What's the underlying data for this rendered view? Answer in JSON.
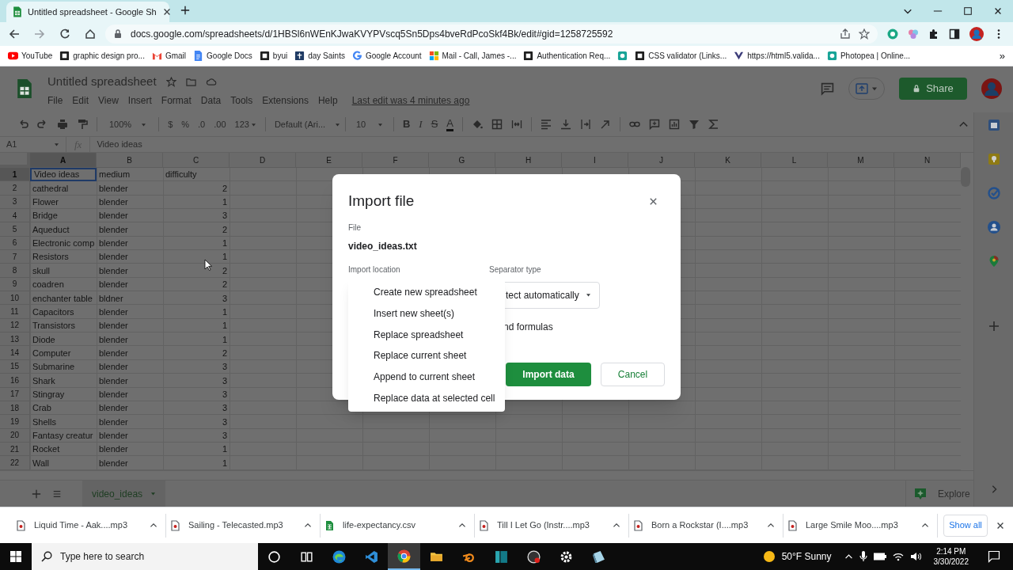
{
  "browser": {
    "tabs": [
      {
        "title": "Untitled spreadsheet - Google Sh",
        "selected": true
      }
    ],
    "url": "docs.google.com/spreadsheets/d/1HBSl6nWEnKJwaKVYPVscq5Sn5Dps4bveRdPcoSkf4Bk/edit#gid=1258725592",
    "bookmarks": [
      {
        "label": "YouTube",
        "kind": "play"
      },
      {
        "label": "graphic design pro...",
        "kind": "dark"
      },
      {
        "label": "Gmail",
        "kind": "mail"
      },
      {
        "label": "Google Docs",
        "kind": "doc"
      },
      {
        "label": "byui",
        "kind": "dark"
      },
      {
        "label": "day Saints",
        "kind": "navy"
      },
      {
        "label": "Google Account",
        "kind": "multi"
      },
      {
        "label": "Mail - Call, James -...",
        "kind": "windows"
      },
      {
        "label": "Authentication Req...",
        "kind": "dark"
      },
      {
        "kind": "teal"
      },
      {
        "label": "CSS validator (Links...",
        "kind": "dark"
      },
      {
        "label": "https://html5.valida...",
        "kind": "figure"
      },
      {
        "label": "Photopea | Online...",
        "kind": "teal"
      }
    ],
    "more": "»"
  },
  "sheets": {
    "title": "Untitled spreadsheet",
    "menus": [
      "File",
      "Edit",
      "View",
      "Insert",
      "Format",
      "Data",
      "Tools",
      "Extensions",
      "Help"
    ],
    "last_edit": "Last edit was 4 minutes ago",
    "share": "Share",
    "toolbar": {
      "zoom": "100%",
      "currency": "$",
      "percent": "%",
      "decrease_decimals": ".0",
      "increase_decimals": ".00",
      "number_format": "123",
      "font": "Default (Ari...",
      "font_size": "10",
      "bold": "B",
      "italic": "I",
      "strikethrough": "S",
      "text_color": "A"
    },
    "name_box": "A1",
    "fx": "fx",
    "formula": "Video ideas",
    "columns": [
      {
        "label": "A",
        "selected": true
      },
      {
        "label": "B",
        "selected": false
      },
      {
        "label": "C",
        "selected": false
      },
      {
        "label": "D",
        "selected": false
      },
      {
        "label": "E",
        "selected": false
      },
      {
        "label": "F",
        "selected": false
      },
      {
        "label": "G",
        "selected": false
      },
      {
        "label": "H",
        "selected": false
      },
      {
        "label": "I",
        "selected": false
      },
      {
        "label": "J",
        "selected": false
      },
      {
        "label": "K",
        "selected": false
      },
      {
        "label": "L",
        "selected": false
      },
      {
        "label": "M",
        "selected": false
      },
      {
        "label": "N",
        "selected": false
      }
    ],
    "rows": [
      {
        "number": "1",
        "selected": true,
        "cells": [
          "Video ideas",
          "medium",
          "difficulty"
        ]
      },
      {
        "number": "2",
        "selected": false,
        "cells": [
          "cathedral",
          "blender",
          "2"
        ]
      },
      {
        "number": "3",
        "selected": false,
        "cells": [
          "Flower",
          "blender",
          "1"
        ]
      },
      {
        "number": "4",
        "selected": false,
        "cells": [
          "Bridge",
          "blender",
          "3"
        ]
      },
      {
        "number": "5",
        "selected": false,
        "cells": [
          "Aqueduct",
          "blender",
          "2"
        ]
      },
      {
        "number": "6",
        "selected": false,
        "cells": [
          "Electronic comp",
          "blender",
          "1"
        ]
      },
      {
        "number": "7",
        "selected": false,
        "cells": [
          "Resistors",
          "blender",
          "1"
        ]
      },
      {
        "number": "8",
        "selected": false,
        "cells": [
          "skull",
          "blender",
          "2"
        ]
      },
      {
        "number": "9",
        "selected": false,
        "cells": [
          "coadren",
          "blender",
          "2"
        ]
      },
      {
        "number": "10",
        "selected": false,
        "cells": [
          "enchanter table",
          "bldner",
          "3"
        ]
      },
      {
        "number": "11",
        "selected": false,
        "cells": [
          "Capacitors",
          "blender",
          "1"
        ]
      },
      {
        "number": "12",
        "selected": false,
        "cells": [
          "Transistors",
          "blender",
          "1"
        ]
      },
      {
        "number": "13",
        "selected": false,
        "cells": [
          "Diode",
          "blender",
          "1"
        ]
      },
      {
        "number": "14",
        "selected": false,
        "cells": [
          "Computer",
          "blender",
          "2"
        ]
      },
      {
        "number": "15",
        "selected": false,
        "cells": [
          "Submarine",
          "blender",
          "3"
        ]
      },
      {
        "number": "16",
        "selected": false,
        "cells": [
          "Shark",
          "blender",
          "3"
        ]
      },
      {
        "number": "17",
        "selected": false,
        "cells": [
          "Stingray",
          "blender",
          "3"
        ]
      },
      {
        "number": "18",
        "selected": false,
        "cells": [
          "Crab",
          "blender",
          "3"
        ]
      },
      {
        "number": "19",
        "selected": false,
        "cells": [
          "Shells",
          "blender",
          "3"
        ]
      },
      {
        "number": "20",
        "selected": false,
        "cells": [
          "Fantasy creatur",
          "blender",
          "3"
        ]
      },
      {
        "number": "21",
        "selected": false,
        "cells": [
          "Rocket",
          "blender",
          "1"
        ]
      },
      {
        "number": "22",
        "selected": false,
        "cells": [
          "Wall",
          "blender",
          "1"
        ]
      }
    ],
    "sheet_tabs": [
      {
        "name": "video_ideas",
        "selected": true
      }
    ],
    "explore": "Explore"
  },
  "dialog": {
    "title": "Import file",
    "file_label": "File",
    "file_name": "video_ideas.txt",
    "location_label": "Import location",
    "location_options": [
      {
        "label": "Create new spreadsheet",
        "selected": false
      },
      {
        "label": "Insert new sheet(s)",
        "selected": false
      },
      {
        "label": "Replace spreadsheet",
        "selected": false
      },
      {
        "label": "Replace current sheet",
        "selected": false
      },
      {
        "label": "Append to current sheet",
        "selected": false
      },
      {
        "label": "Replace data at selected cell",
        "selected": false
      }
    ],
    "separator_label": "Separator type",
    "separator_value": "tect automatically",
    "convert_label": "nd formulas",
    "import_button": "Import data",
    "cancel_button": "Cancel"
  },
  "downloads": {
    "items": [
      {
        "name": "Liquid Time - Aak....mp3",
        "kind": "audio"
      },
      {
        "name": "Sailing - Telecasted.mp3",
        "kind": "audio"
      },
      {
        "name": "life-expectancy.csv",
        "kind": "sheet"
      },
      {
        "name": "Till I Let Go (Instr....mp3",
        "kind": "audio"
      },
      {
        "name": "Born a Rockstar (I....mp3",
        "kind": "audio"
      },
      {
        "name": "Large Smile Moo....mp3",
        "kind": "audio"
      }
    ],
    "show_all": "Show all"
  },
  "taskbar": {
    "search_placeholder": "Type here to search",
    "apps": [
      {
        "kind": "circle",
        "selected": false
      },
      {
        "kind": "taskview",
        "selected": false
      },
      {
        "kind": "wave",
        "selected": false
      },
      {
        "kind": "ribbon",
        "selected": false
      },
      {
        "kind": "ball",
        "selected": true
      },
      {
        "kind": "folder",
        "selected": false
      },
      {
        "kind": "orange",
        "selected": false
      },
      {
        "kind": "bars",
        "selected": false
      },
      {
        "kind": "record",
        "selected": false
      },
      {
        "kind": "gear",
        "selected": false
      },
      {
        "kind": "glass",
        "selected": false
      }
    ],
    "weather": "50°F Sunny",
    "time": "2:14 PM",
    "date": "3/30/2022"
  }
}
